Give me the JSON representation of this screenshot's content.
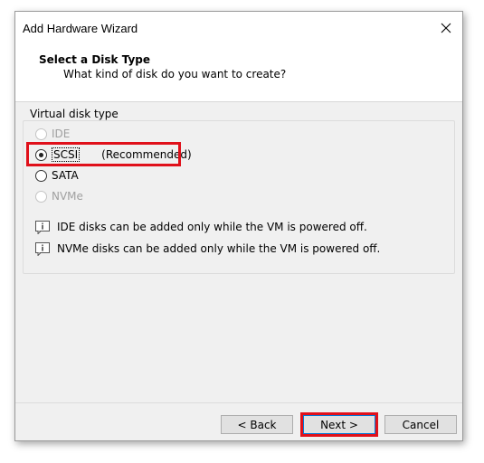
{
  "window": {
    "title": "Add Hardware Wizard",
    "close_icon": "close-icon"
  },
  "header": {
    "title": "Select a Disk Type",
    "subtitle": "What kind of disk do you want to create?"
  },
  "group": {
    "label": "Virtual disk type",
    "options": [
      {
        "label": "IDE",
        "enabled": false,
        "checked": false
      },
      {
        "label": "SCSI",
        "note": "(Recommended)",
        "enabled": true,
        "checked": true
      },
      {
        "label": "SATA",
        "enabled": true,
        "checked": false
      },
      {
        "label": "NVMe",
        "enabled": false,
        "checked": false
      }
    ]
  },
  "info": [
    {
      "icon": "info-icon",
      "text": "IDE disks can be added only while the VM is powered off."
    },
    {
      "icon": "info-icon",
      "text": "NVMe disks can be added only while the VM is powered off."
    }
  ],
  "buttons": {
    "back": "< Back",
    "next": "Next >",
    "cancel": "Cancel"
  },
  "colors": {
    "highlight": "#e0101a",
    "window_bg": "#f0f0f0",
    "button_bg": "#e1e1e1"
  }
}
